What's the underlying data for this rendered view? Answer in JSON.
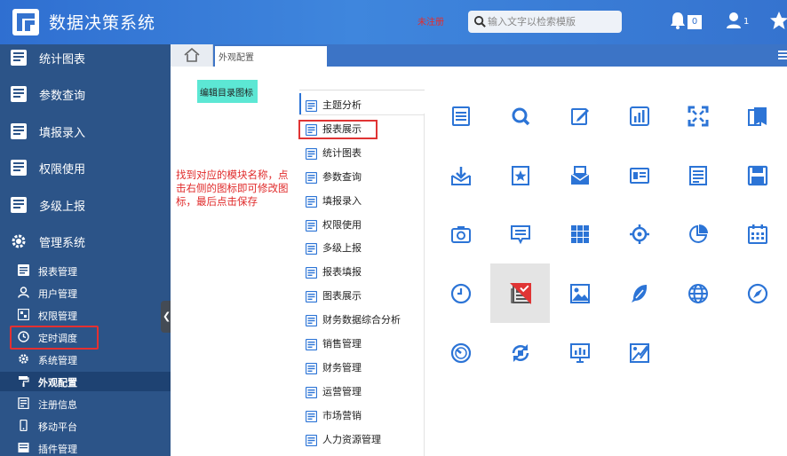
{
  "header": {
    "app_title": "数据决策系统",
    "unregistered": "未注册",
    "search_placeholder": "输入文字以检索模版",
    "notification_count": "0",
    "user_count": "1"
  },
  "sidebar": {
    "main_items": [
      {
        "label": "统计图表",
        "icon": "report-icon"
      },
      {
        "label": "参数查询",
        "icon": "report-icon"
      },
      {
        "label": "填报录入",
        "icon": "report-icon"
      },
      {
        "label": "权限使用",
        "icon": "report-icon"
      },
      {
        "label": "多级上报",
        "icon": "report-icon"
      },
      {
        "label": "管理系统",
        "icon": "gear-icon"
      }
    ],
    "sub_items": [
      {
        "label": "报表管理",
        "icon": "report-icon"
      },
      {
        "label": "用户管理",
        "icon": "user-icon"
      },
      {
        "label": "权限管理",
        "icon": "shield-icon"
      },
      {
        "label": "定时调度",
        "icon": "clock-icon"
      },
      {
        "label": "系统管理",
        "icon": "gear-icon"
      },
      {
        "label": "外观配置",
        "icon": "paint-roller-icon"
      },
      {
        "label": "注册信息",
        "icon": "register-icon"
      },
      {
        "label": "移动平台",
        "icon": "mobile-icon"
      },
      {
        "label": "插件管理",
        "icon": "plugin-icon"
      }
    ]
  },
  "tabs": {
    "current": "外观配置"
  },
  "content": {
    "edit_button": "编辑目录图标",
    "instruction_note": "找到对应的模块名称，点击右侧的图标即可修改图标，最后点击保存",
    "module_list": [
      "主题分析",
      "报表展示",
      "统计图表",
      "参数查询",
      "填报录入",
      "权限使用",
      "多级上报",
      "报表填报",
      "图表展示",
      "财务数据综合分析",
      "销售管理",
      "财务管理",
      "运营管理",
      "市场营销",
      "人力资源管理"
    ],
    "icon_grid": [
      [
        "list-doc-icon",
        "search-zoom-icon",
        "edit-icon",
        "bar-chart-icon",
        "fullscreen-icon",
        "bookmark-docs-icon"
      ],
      [
        "inbox-icon",
        "star-doc-icon",
        "mail-print-icon",
        "id-card-icon",
        "document-icon",
        "floppy-icon"
      ],
      [
        "camera-icon",
        "message-icon",
        "grid-icon",
        "target-icon",
        "pie-chart-icon",
        "calendar-icon"
      ],
      [
        "clock-icon",
        "newspaper-icon",
        "image-icon",
        "feather-icon",
        "globe-icon",
        "compass-icon"
      ],
      [
        "gauge-icon",
        "sync-icon",
        "presentation-icon",
        "image-edit-icon"
      ]
    ],
    "selected_icon": "newspaper-icon"
  },
  "colors": {
    "header_blue": "#3573cf",
    "sidebar_bg": "#2c5488",
    "icon_blue": "#2c74d6",
    "highlight_red": "#e03434",
    "edit_button_bg": "#5ce7d4"
  }
}
